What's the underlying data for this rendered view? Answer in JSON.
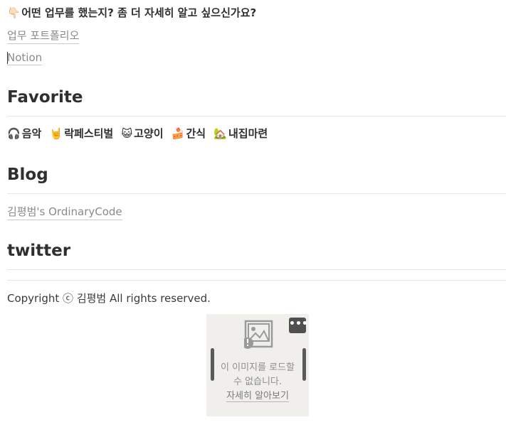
{
  "question": {
    "emoji": "👇🏻",
    "text": "어떤 업무를 했는지? 좀 더 자세히 알고 싶으신가요?"
  },
  "links": {
    "portfolio": "업무 포트폴리오",
    "notion": "Notion",
    "blog": "김평범's OrdinaryCode"
  },
  "sections": {
    "favorite": "Favorite",
    "blog": "Blog",
    "twitter": "twitter"
  },
  "favorites": [
    {
      "emoji": "🎧",
      "label": "음악",
      "icon": "headphones-icon"
    },
    {
      "emoji": "🤘",
      "label": "락페스티벌",
      "icon": "rock-hand-icon"
    },
    {
      "emoji": "😺",
      "label": "고양이",
      "icon": "cat-icon"
    },
    {
      "emoji": "🍰",
      "label": "간식",
      "icon": "cake-icon"
    },
    {
      "emoji": "🏡",
      "label": "내집마련",
      "icon": "house-icon"
    }
  ],
  "footer": {
    "copyright": "Copyright ⓒ 김평범 All rights reserved."
  },
  "broken_image": {
    "message": "이 이미지를 로드할 수 없습니다.",
    "learn_more": "자세히 알아보기",
    "more_label": "•••"
  }
}
